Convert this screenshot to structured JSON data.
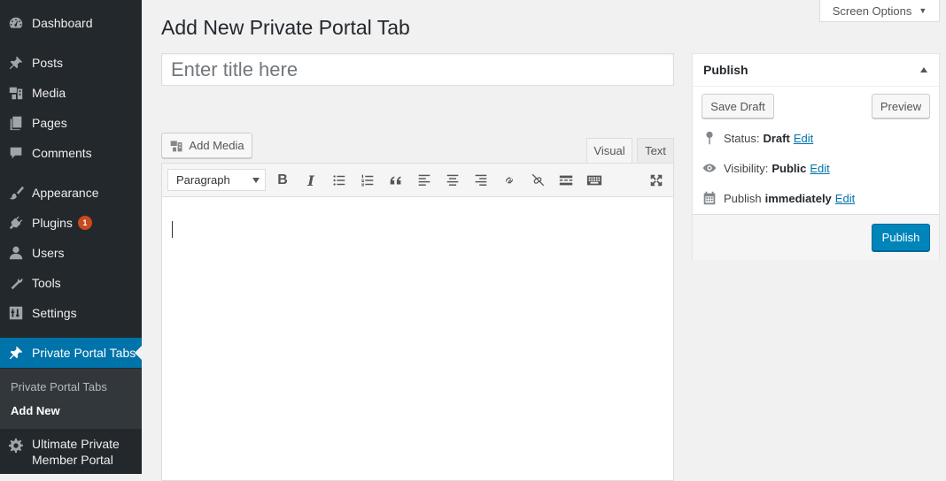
{
  "sidebar": {
    "items": [
      {
        "label": "Dashboard",
        "icon": "dashboard-icon"
      },
      {
        "label": "Posts",
        "icon": "pin-icon"
      },
      {
        "label": "Media",
        "icon": "media-icon"
      },
      {
        "label": "Pages",
        "icon": "pages-icon"
      },
      {
        "label": "Comments",
        "icon": "comment-icon"
      },
      {
        "label": "Appearance",
        "icon": "brush-icon"
      },
      {
        "label": "Plugins",
        "icon": "plugin-icon",
        "badge": "1"
      },
      {
        "label": "Users",
        "icon": "user-icon"
      },
      {
        "label": "Tools",
        "icon": "wrench-icon"
      },
      {
        "label": "Settings",
        "icon": "settings-icon"
      },
      {
        "label": "Private Portal Tabs",
        "icon": "pin-icon"
      },
      {
        "label": "Ultimate Private",
        "label2": "Member Portal",
        "icon": "gear-icon"
      }
    ],
    "submenu": [
      {
        "label": "Private Portal Tabs"
      },
      {
        "label": "Add New"
      }
    ]
  },
  "screen_options": "Screen Options",
  "page_title": "Add New Private Portal Tab",
  "title_input": {
    "placeholder": "Enter title here",
    "value": ""
  },
  "editor": {
    "add_media": "Add Media",
    "tabs": {
      "visual": "Visual",
      "text": "Text"
    },
    "format": "Paragraph",
    "toolbar": [
      "bold",
      "italic",
      "bullet-list",
      "numbered-list",
      "blockquote",
      "align-left",
      "align-center",
      "align-right",
      "link",
      "unlink",
      "read-more",
      "toolbar-toggle",
      "fullscreen"
    ]
  },
  "publish": {
    "title": "Publish",
    "save_draft": "Save Draft",
    "preview": "Preview",
    "status": {
      "label": "Status:",
      "value": "Draft",
      "edit": "Edit"
    },
    "visibility": {
      "label": "Visibility:",
      "value": "Public",
      "edit": "Edit"
    },
    "schedule": {
      "label": "Publish",
      "value": "immediately",
      "edit": "Edit"
    },
    "publish_button": "Publish"
  },
  "colors": {
    "sidebar": "#23282d",
    "accent": "#0073aa",
    "primary_button": "#0085ba",
    "badge": "#ca4a1f"
  }
}
